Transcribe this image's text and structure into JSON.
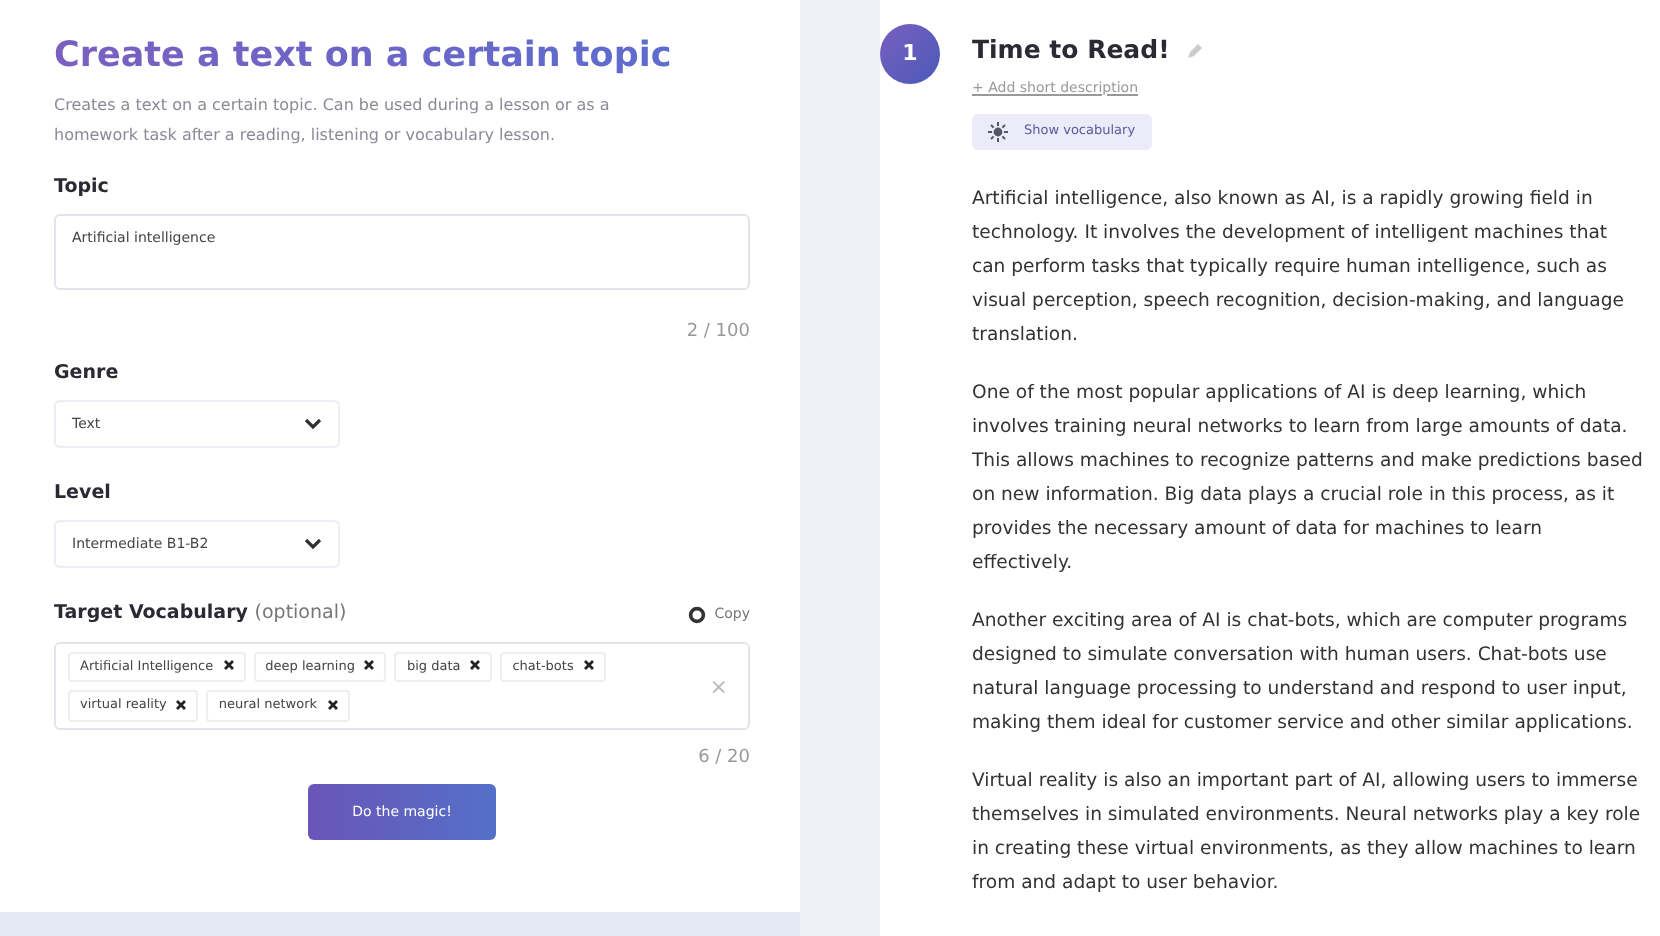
{
  "form": {
    "title": "Create a text on a certain topic",
    "description": "Creates a text on a certain topic. Can be used during a lesson or as a homework task after a reading, listening or vocabulary lesson.",
    "topic": {
      "label": "Topic",
      "value": "Artificial intelligence",
      "counter": "2 / 100"
    },
    "genre": {
      "label": "Genre",
      "value": "Text"
    },
    "level": {
      "label": "Level",
      "value": "Intermediate B1-B2"
    },
    "vocabulary": {
      "label": "Target Vocabulary",
      "hint": "(optional)",
      "copy": "Copy",
      "clear": "×",
      "counter": "6 / 20",
      "tags": [
        {
          "text": "Artificial Intelligence"
        },
        {
          "text": "deep learning"
        },
        {
          "text": "big data"
        },
        {
          "text": "chat-bots"
        },
        {
          "text": "virtual reality"
        },
        {
          "text": "neural network"
        }
      ]
    },
    "submit": "Do the magic!"
  },
  "step": {
    "number": "1",
    "title": "Time to Read!",
    "add_description": "+ Add short description",
    "vocab_button": "Show vocabulary",
    "paragraphs": [
      "Artificial intelligence, also known as AI, is a rapidly growing field in technology. It involves the development of intelligent machines that can perform tasks that typically require human intelligence, such as visual perception, speech recognition, decision-making, and language translation.",
      "One of the most popular applications of AI is deep learning, which involves training neural networks to learn from large amounts of data. This allows machines to recognize patterns and make predictions based on new information. Big data plays a crucial role in this process, as it provides the necessary amount of data for machines to learn effectively.",
      "Another exciting area of AI is chat-bots, which are computer programs designed to simulate conversation with human users. Chat-bots use natural language processing to understand and respond to user input, making them ideal for customer service and other similar applications.",
      "Virtual reality is also an important part of AI, allowing users to immerse themselves in simulated environments. Neural networks play a key role in creating these virtual environments, as they allow machines to learn from and adapt to user behavior."
    ]
  }
}
